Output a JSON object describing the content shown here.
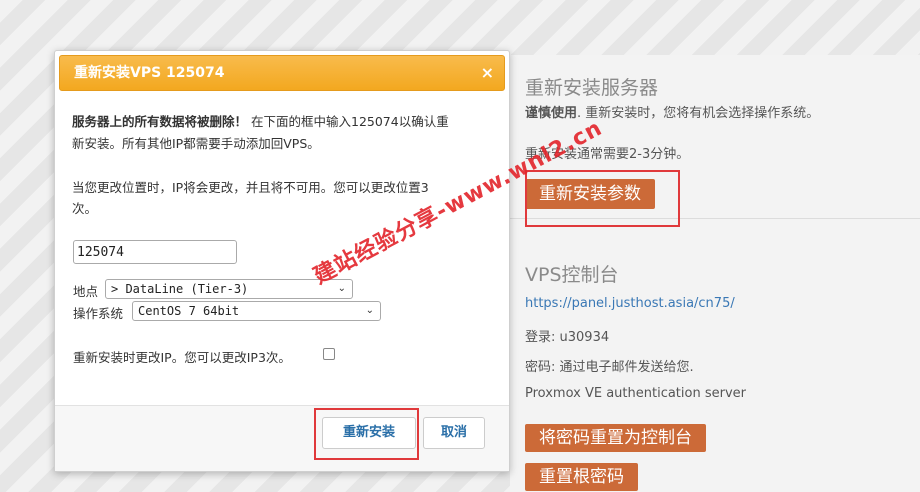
{
  "page": {
    "reinstall_title": "重新安装服务器",
    "caution_bold": "谨慎使用",
    "caution_text": ". 重新安装时，您将有机会选择操作系统。",
    "duration_text": "重新安装通常需要2-3分钟。",
    "reinstall_params_button": "重新安装参数",
    "vps_console_title": "VPS控制台",
    "console_url": "https://panel.justhost.asia/cn75/",
    "login_text": "登录: u30934",
    "password_text": "密码: 通过电子邮件发送给您.",
    "auth_text": "Proxmox VE authentication server",
    "reset_console_password_button": "将密码重置为控制台",
    "reset_root_password_button": "重置根密码"
  },
  "modal": {
    "title": "重新安装VPS 125074",
    "close_label": "×",
    "warning_bold": "服务器上的所有数据将被删除！",
    "warning_text_line1": "在下面的框中输入125074以确认重",
    "warning_text_line2": "新安装。所有其他IP都需要手动添加回VPS。",
    "ip_note_line1": "当您更改位置时，IP将会更改，并且将不可用。您可以更改位置3",
    "ip_note_line2": "次。",
    "confirm_input_value": "125074",
    "location_label": "地点",
    "location_value": "> DataLine (Tier-3)",
    "os_label": "操作系统",
    "os_value": "CentOS 7 64bit",
    "change_ip_label": "重新安装时更改IP。您可以更改IP3次。",
    "reinstall_button": "重新安装",
    "cancel_button": "取消"
  },
  "watermark": "建站经验分享-www.wnl2.cn",
  "colors": {
    "accent_orange": "#cc6a38",
    "header_orange": "#f3a81f",
    "highlight_red": "#e0393b",
    "link_blue": "#3a78b5"
  }
}
